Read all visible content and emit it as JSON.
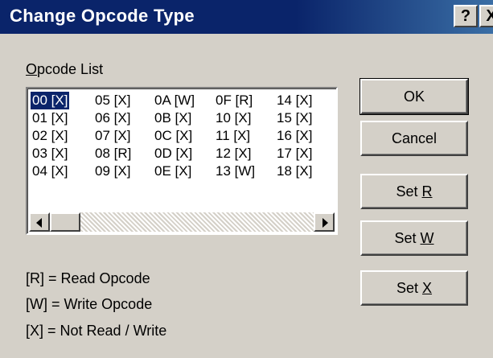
{
  "window": {
    "title": "Change Opcode Type",
    "help_button": "?",
    "close_button": "X"
  },
  "opcode_list": {
    "label_prefix": "O",
    "label_rest": "pcode List",
    "selected": "00 [X]",
    "columns": [
      [
        "00 [X]",
        "01 [X]",
        "02 [X]",
        "03 [X]",
        "04 [X]"
      ],
      [
        "05 [X]",
        "06 [X]",
        "07 [X]",
        "08 [R]",
        "09 [X]"
      ],
      [
        "0A [W]",
        "0B [X]",
        "0C [X]",
        "0D [X]",
        "0E [X]"
      ],
      [
        "0F [R]",
        "10 [X]",
        "11 [X]",
        "12 [X]",
        "13 [W]"
      ],
      [
        "14 [X]",
        "15 [X]",
        "16 [X]",
        "17 [X]",
        "18 [X]"
      ]
    ]
  },
  "buttons": {
    "ok": "OK",
    "cancel": "Cancel",
    "set_r_prefix": "Set ",
    "set_r_key": "R",
    "set_w_prefix": "Set ",
    "set_w_key": "W",
    "set_x_prefix": "Set ",
    "set_x_key": "X"
  },
  "legend": {
    "read": "[R] = Read Opcode",
    "write": "[W] = Write Opcode",
    "none": "[X] = Not Read / Write"
  }
}
